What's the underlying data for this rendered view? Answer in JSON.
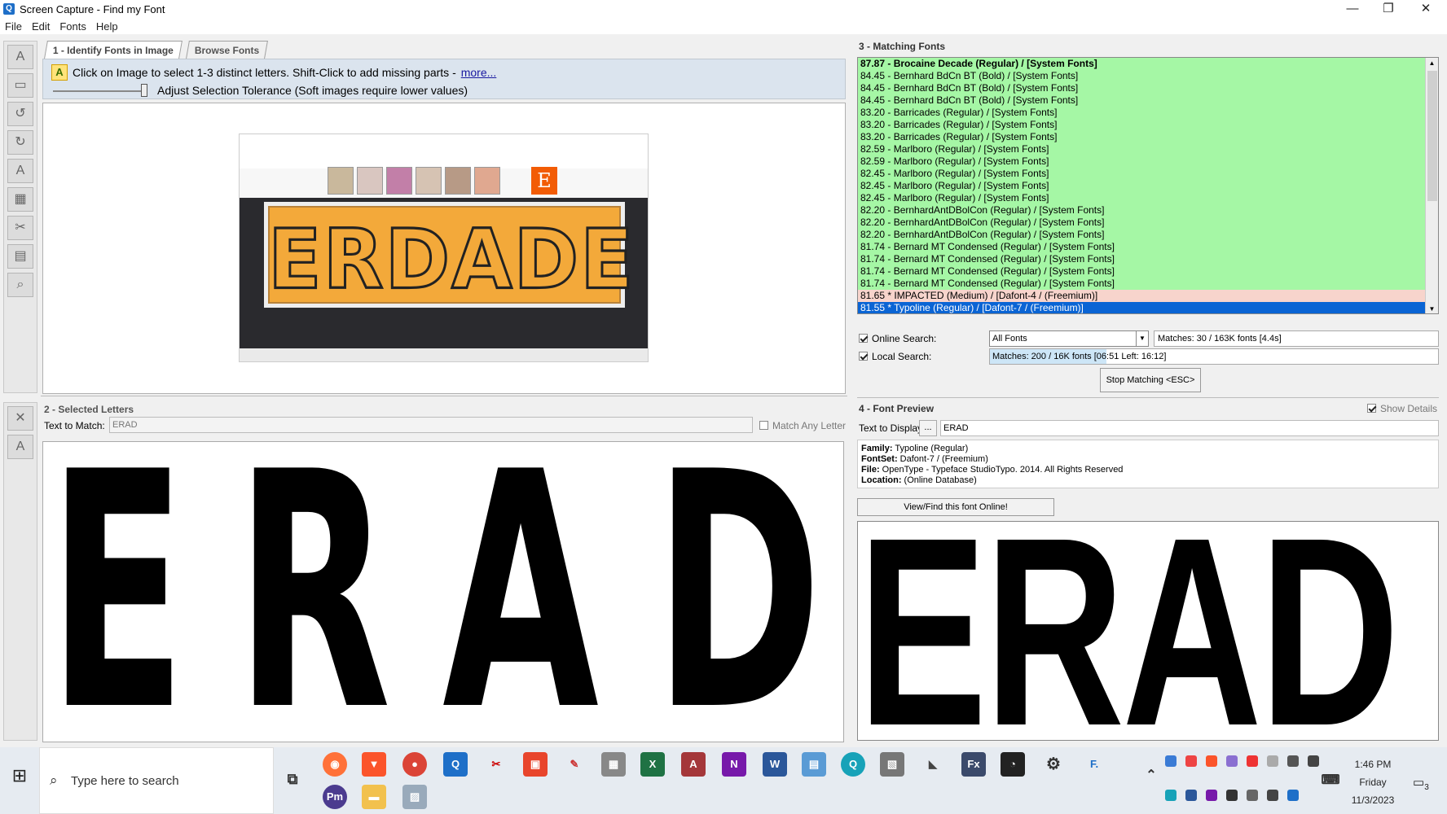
{
  "window": {
    "title": "Screen Capture - Find my Font",
    "minimize": "—",
    "maximize": "❐",
    "close": "✕"
  },
  "menu": [
    "File",
    "Edit",
    "Fonts",
    "Help"
  ],
  "panel1": {
    "tab_identify": "1 - Identify Fonts in Image",
    "tab_browse": "Browse Fonts",
    "hint": "Click on Image to select 1-3 distinct letters. Shift-Click to add missing parts -",
    "more_link": "more...",
    "tolerance": "Adjust Selection Tolerance (Soft images require lower values)",
    "image_banner_text": "ERDADE",
    "image_icon_letter": "E"
  },
  "panel2": {
    "title": "2 - Selected Letters",
    "text_to_match_label": "Text to Match:",
    "text_to_match_value": "ERAD",
    "match_any_letter": "Match Any Letter",
    "letters": [
      "E",
      "R",
      "A",
      "D"
    ]
  },
  "panel3": {
    "title": "3 - Matching Fonts",
    "matches": [
      {
        "text": "87.87 - Brocaine Decade (Regular) / [System Fonts]",
        "style": "top"
      },
      {
        "text": "84.45 - Bernhard BdCn BT (Bold) / [System Fonts]",
        "style": ""
      },
      {
        "text": "84.45 - Bernhard BdCn BT (Bold) / [System Fonts]",
        "style": ""
      },
      {
        "text": "84.45 - Bernhard BdCn BT (Bold) / [System Fonts]",
        "style": ""
      },
      {
        "text": "83.20 - Barricades (Regular) / [System Fonts]",
        "style": ""
      },
      {
        "text": "83.20 - Barricades (Regular) / [System Fonts]",
        "style": ""
      },
      {
        "text": "83.20 - Barricades (Regular) / [System Fonts]",
        "style": ""
      },
      {
        "text": "82.59 - Marlboro (Regular) / [System Fonts]",
        "style": ""
      },
      {
        "text": "82.59 - Marlboro (Regular) / [System Fonts]",
        "style": ""
      },
      {
        "text": "82.45 - Marlboro (Regular) / [System Fonts]",
        "style": ""
      },
      {
        "text": "82.45 - Marlboro (Regular) / [System Fonts]",
        "style": ""
      },
      {
        "text": "82.45 - Marlboro (Regular) / [System Fonts]",
        "style": ""
      },
      {
        "text": "82.20 - BernhardAntDBolCon (Regular) / [System Fonts]",
        "style": ""
      },
      {
        "text": "82.20 - BernhardAntDBolCon (Regular) / [System Fonts]",
        "style": ""
      },
      {
        "text": "82.20 - BernhardAntDBolCon (Regular) / [System Fonts]",
        "style": ""
      },
      {
        "text": "81.74 - Bernard MT Condensed (Regular) / [System Fonts]",
        "style": ""
      },
      {
        "text": "81.74 - Bernard MT Condensed (Regular) / [System Fonts]",
        "style": ""
      },
      {
        "text": "81.74 - Bernard MT Condensed (Regular) / [System Fonts]",
        "style": ""
      },
      {
        "text": "81.74 - Bernard MT Condensed (Regular) / [System Fonts]",
        "style": ""
      },
      {
        "text": "81.65 * IMPACTED (Medium) / [Dafont-4 / (Freemium)]",
        "style": "pink"
      },
      {
        "text": "81.55 * Typoline (Regular) / [Dafont-7 / (Freemium)]",
        "style": "sel"
      }
    ],
    "online_search_label": "Online Search:",
    "online_search_select": "All Fonts",
    "online_matches": "Matches: 30 / 163K fonts [4.4s]",
    "local_search_label": "Local Search:",
    "local_matches": "Matches: 200 / 16K fonts [06:51 Left: 16:12]",
    "local_progress": 0.26,
    "stop_button": "Stop Matching  <ESC>"
  },
  "panel4": {
    "title": "4 - Font Preview",
    "show_details": "Show Details",
    "text_to_display_label": "Text to Display:",
    "dots": "...",
    "text_to_display_value": "ERAD",
    "family_label": "Family:",
    "family_value": " Typoline (Regular)",
    "fontset_label": "FontSet:",
    "fontset_value": " Dafont-7 / (Freemium)",
    "file_label": "File:",
    "file_value": " OpenType  - Typeface  StudioTypo. 2014. All Rights Reserved",
    "location_label": "Location:",
    "location_value": " (Online Database)",
    "view_button": "View/Find this font Online!",
    "preview_text": "ERAD"
  },
  "taskbar": {
    "search_placeholder": "Type here to search",
    "time": "1:46 PM",
    "day": "Friday",
    "date": "11/3/2023",
    "notif_count": "3"
  }
}
